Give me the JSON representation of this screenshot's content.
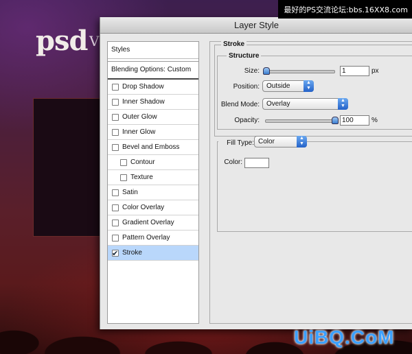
{
  "background": {
    "logo_text": "psd",
    "logo_partial": "V"
  },
  "watermarks": {
    "top": "最好的PS交流论坛:bbs.16XX8.com",
    "bottom": "UiBQ.CoM"
  },
  "dialog": {
    "title": "Layer Style",
    "left_panel": {
      "header": "Styles",
      "blending_options": "Blending Options: Custom",
      "items": [
        {
          "label": "Drop Shadow",
          "checked": false,
          "indent": false
        },
        {
          "label": "Inner Shadow",
          "checked": false,
          "indent": false
        },
        {
          "label": "Outer Glow",
          "checked": false,
          "indent": false
        },
        {
          "label": "Inner Glow",
          "checked": false,
          "indent": false
        },
        {
          "label": "Bevel and Emboss",
          "checked": false,
          "indent": false
        },
        {
          "label": "Contour",
          "checked": false,
          "indent": true
        },
        {
          "label": "Texture",
          "checked": false,
          "indent": true
        },
        {
          "label": "Satin",
          "checked": false,
          "indent": false
        },
        {
          "label": "Color Overlay",
          "checked": false,
          "indent": false
        },
        {
          "label": "Gradient Overlay",
          "checked": false,
          "indent": false
        },
        {
          "label": "Pattern Overlay",
          "checked": false,
          "indent": false
        },
        {
          "label": "Stroke",
          "checked": true,
          "indent": false,
          "selected": true
        }
      ]
    },
    "stroke": {
      "title": "Stroke",
      "structure_title": "Structure",
      "size_label": "Size:",
      "size_value": "1",
      "size_unit": "px",
      "position_label": "Position:",
      "position_value": "Outside",
      "blend_mode_label": "Blend Mode:",
      "blend_mode_value": "Overlay",
      "opacity_label": "Opacity:",
      "opacity_value": "100",
      "opacity_unit": "%",
      "fill_type_label": "Fill Type:",
      "fill_type_value": "Color",
      "color_label": "Color:",
      "color_value": "#ffffff"
    }
  }
}
